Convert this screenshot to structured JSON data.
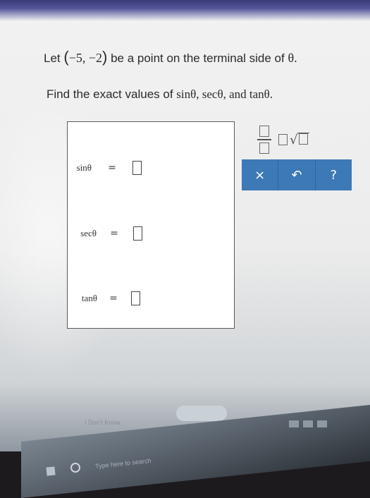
{
  "question": {
    "prefix": "Let",
    "point": "−5, −2",
    "suffix": "be a point on the terminal side of",
    "theta": "θ."
  },
  "instruction": {
    "prefix": "Find the exact values of",
    "functions": "sinθ, secθ, and tanθ."
  },
  "answers": {
    "sin": {
      "label": "sinθ",
      "equals": "="
    },
    "sec": {
      "label": "secθ",
      "equals": "="
    },
    "tan": {
      "label": "tanθ",
      "equals": "="
    }
  },
  "palette": {
    "clear_label": "×",
    "undo_label": "↶",
    "help_label": "?"
  },
  "footer": {
    "dont_know": "I Don't Know",
    "search_placeholder": "Type here to search"
  },
  "colors": {
    "accent": "#3c79b6"
  }
}
